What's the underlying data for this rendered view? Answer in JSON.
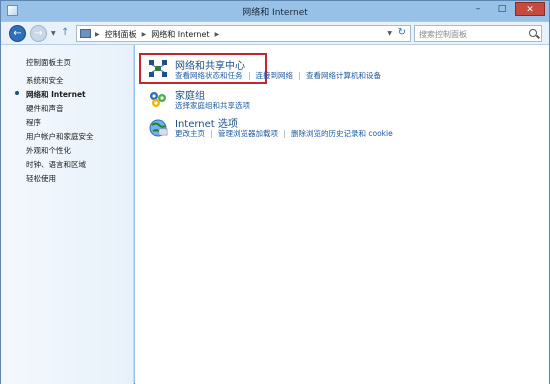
{
  "window": {
    "title": "网络和 Internet",
    "captions": {
      "minimize": "–",
      "maximize": "□",
      "close": "✕"
    }
  },
  "nav": {
    "back": "←",
    "forward": "→",
    "up": "↑",
    "breadcrumbs": [
      "控制面板",
      "网络和 Internet"
    ],
    "search_placeholder": "搜索控制面板"
  },
  "sidebar": {
    "home": "控制面板主页",
    "items": [
      {
        "label": "系统和安全",
        "current": false
      },
      {
        "label": "网络和 Internet",
        "current": true
      },
      {
        "label": "硬件和声音",
        "current": false
      },
      {
        "label": "程序",
        "current": false
      },
      {
        "label": "用户帐户和家庭安全",
        "current": false
      },
      {
        "label": "外观和个性化",
        "current": false
      },
      {
        "label": "时钟、语言和区域",
        "current": false
      },
      {
        "label": "轻松使用",
        "current": false
      }
    ]
  },
  "categories": [
    {
      "icon": "network-sharing-center-icon",
      "title": "网络和共享中心",
      "links": [
        "查看网络状态和任务",
        "连接到网络",
        "查看网络计算机和设备"
      ]
    },
    {
      "icon": "homegroup-icon",
      "title": "家庭组",
      "links": [
        "选择家庭组和共享选项"
      ]
    },
    {
      "icon": "internet-options-icon",
      "title": "Internet 选项",
      "links": [
        "更改主页",
        "管理浏览器加载项",
        "删除浏览的历史记录和 cookie"
      ]
    }
  ],
  "colors": {
    "highlight_border": "#c1272d",
    "link": "#1d5aa0",
    "title_link": "#1e4f86"
  }
}
